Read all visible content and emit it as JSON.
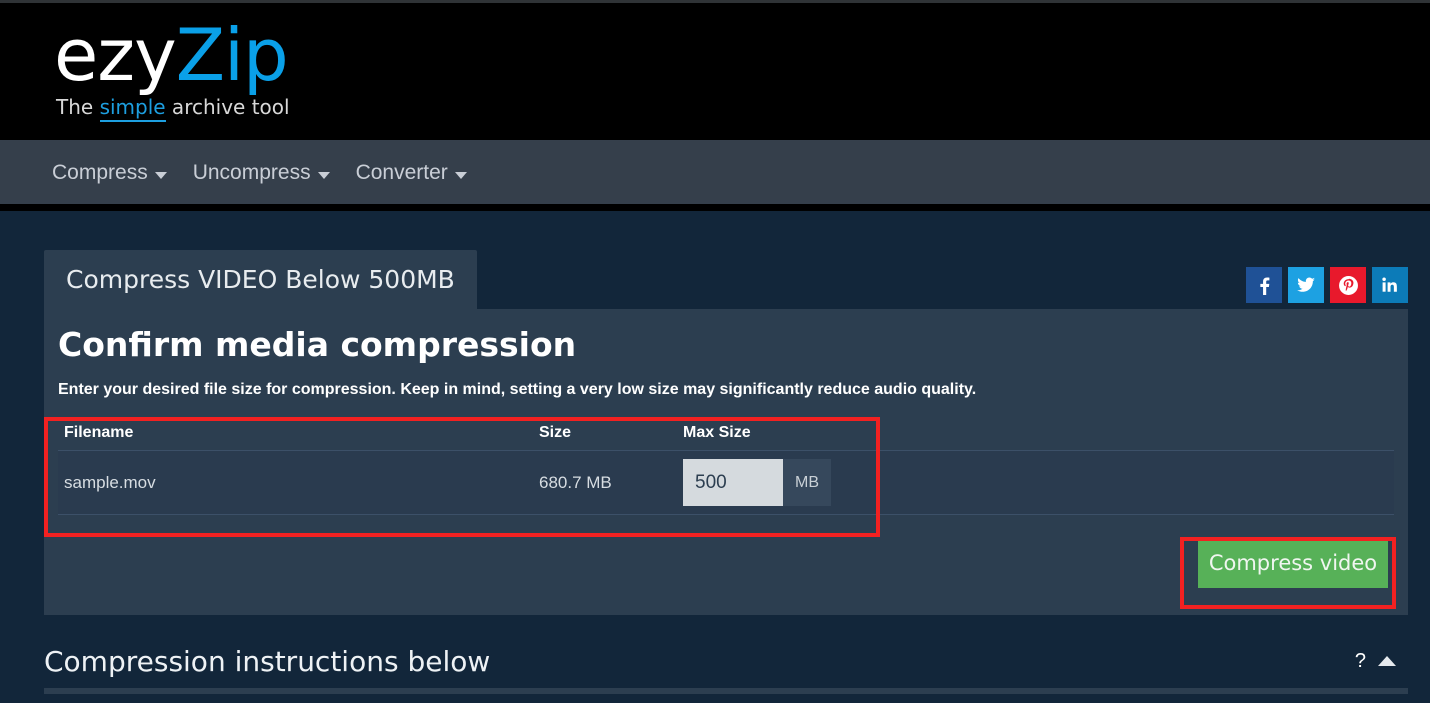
{
  "header": {
    "logo_primary": "ezy",
    "logo_accent": "Zip",
    "tagline_before": "The ",
    "tagline_highlight": "simple",
    "tagline_after": " archive tool"
  },
  "nav": {
    "items": [
      {
        "label": "Compress",
        "icon": "chevron-down-icon"
      },
      {
        "label": "Uncompress",
        "icon": "chevron-down-icon"
      },
      {
        "label": "Converter",
        "icon": "chevron-down-icon"
      }
    ]
  },
  "social": [
    {
      "name": "facebook",
      "glyph": "f",
      "color": "#1f5196"
    },
    {
      "name": "twitter",
      "glyph": "t",
      "color": "#1da1e2"
    },
    {
      "name": "pinterest",
      "glyph": "p",
      "color": "#e8192c"
    },
    {
      "name": "linkedin",
      "glyph": "in",
      "color": "#0c7bb8"
    }
  ],
  "panel": {
    "tab_label": "Compress VIDEO Below 500MB",
    "heading": "Confirm media compression",
    "subtext": "Enter your desired file size for compression. Keep in mind, setting a very low size may significantly reduce audio quality.",
    "table": {
      "columns": [
        "Filename",
        "Size",
        "Max Size"
      ],
      "rows": [
        {
          "filename": "sample.mov",
          "size": "680.7 MB",
          "max_size_value": "500",
          "max_size_placeholder": "500",
          "max_size_unit": "MB"
        }
      ]
    },
    "action_button": "Compress video",
    "action_button_color": "#57b158"
  },
  "instructions": {
    "title": "Compression instructions below",
    "help_glyph": "?",
    "toggle_icon": "caret-up-icon"
  },
  "annotations": {
    "highlight_color": "#f32121",
    "table_region": "file-table",
    "button_region": "compress-video-button"
  }
}
